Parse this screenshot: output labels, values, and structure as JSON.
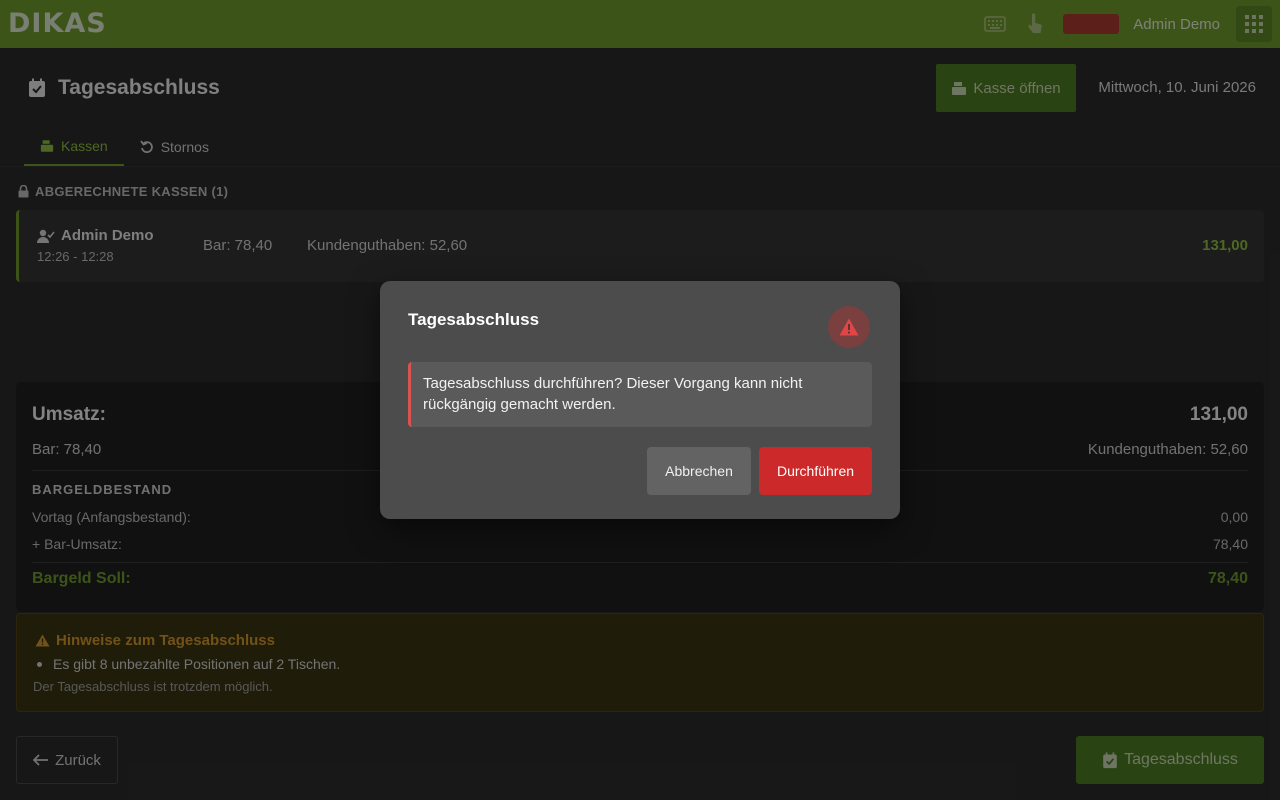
{
  "app": {
    "logo_text": "DIKAS",
    "user_name": "Admin Demo",
    "icons": [
      "keyboard-icon",
      "touch-icon",
      "apps-grid-icon"
    ]
  },
  "header": {
    "title": "Tagesabschluss",
    "open_register_label": "Kasse öffnen",
    "date": "Mittwoch, 10. Juni 2026"
  },
  "tabs": [
    {
      "label": "Kassen",
      "active": true
    },
    {
      "label": "Stornos",
      "active": false
    }
  ],
  "closed_registers": {
    "heading": "ABGERECHNETE KASSEN (1)",
    "items": [
      {
        "name": "Admin Demo",
        "time": "12:26 - 12:28",
        "bar": "Bar: 78,40",
        "credit": "Kundenguthaben: 52,60",
        "total": "131,00"
      }
    ]
  },
  "summary": {
    "revenue_label": "Umsatz:",
    "revenue_value": "131,00",
    "bar": "Bar: 78,40",
    "credit": "Kundenguthaben: 52,60",
    "cash_heading": "BARGELDBESTAND",
    "lines": [
      {
        "label": "Vortag (Anfangsbestand):",
        "value": "0,00"
      },
      {
        "label": "+ Bar-Umsatz:",
        "value": "78,40"
      }
    ],
    "target_label": "Bargeld Soll:",
    "target_value": "78,40"
  },
  "notice": {
    "title": "Hinweise zum Tagesabschluss",
    "items": [
      "Es gibt 8 unbezahlte Positionen auf 2 Tischen."
    ],
    "footnote": "Der Tagesabschluss ist trotzdem möglich."
  },
  "footer": {
    "back_label": "Zurück",
    "close_day_label": "Tagesabschluss"
  },
  "modal": {
    "title": "Tagesabschluss",
    "message": "Tagesabschluss durchführen? Dieser Vorgang kann nicht rückgängig gemacht werden.",
    "cancel_label": "Abbrechen",
    "confirm_label": "Durchführen"
  },
  "colors": {
    "brand_green": "#6f9a2f",
    "danger_red": "#cc2a2a",
    "warning_orange": "#d0962a"
  }
}
